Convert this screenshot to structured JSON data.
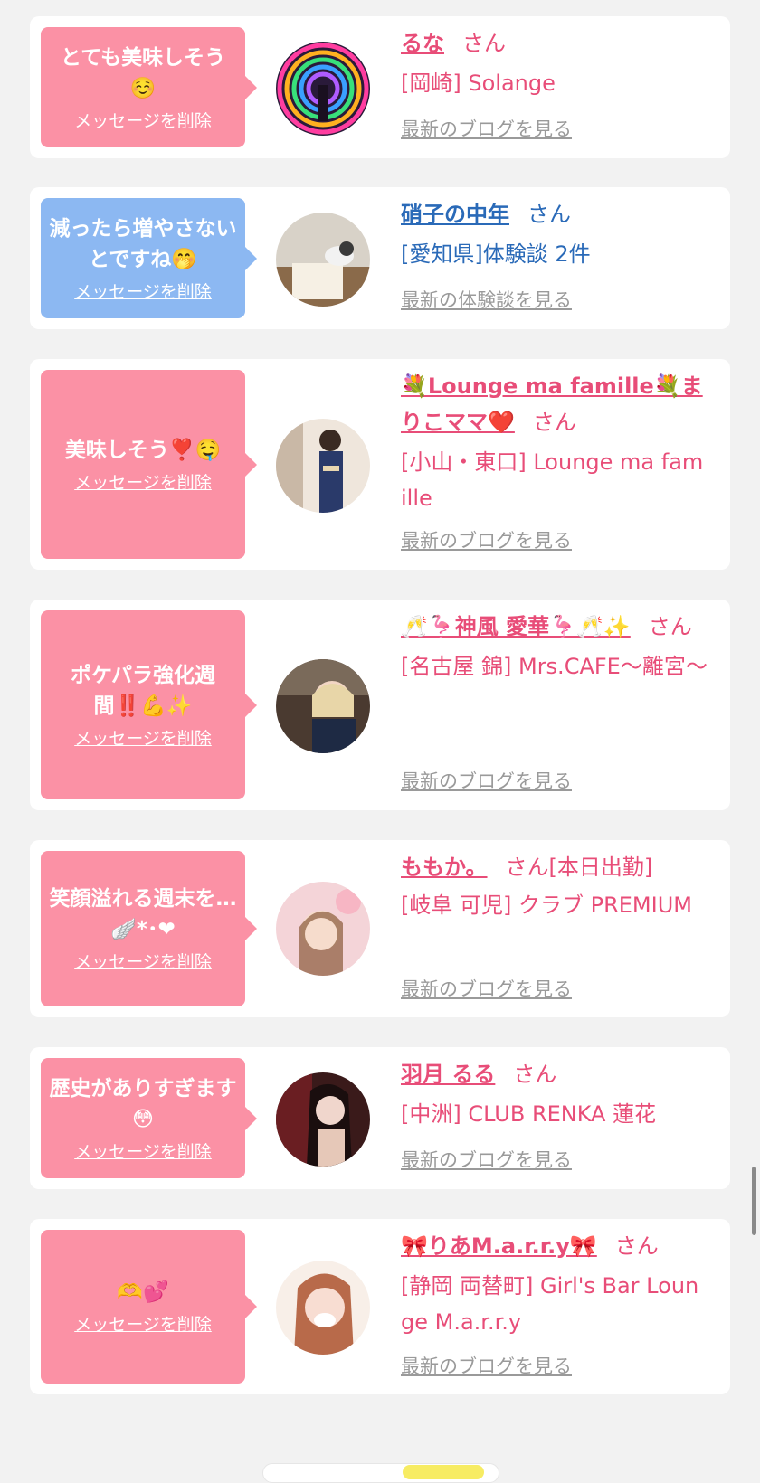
{
  "entries": [
    {
      "message": "とても美味しそう☺️",
      "delete_label": "メッセージを削除",
      "name": "るな",
      "honorific": "さん",
      "store": "[岡崎] Solange",
      "link": "最新のブログを見る"
    },
    {
      "message": "減ったら増やさないとですね🤭",
      "delete_label": "メッセージを削除",
      "name": "硝子の中年",
      "honorific": "さん",
      "store": "[愛知県]体験談 2件",
      "link": "最新の体験談を見る"
    },
    {
      "message": "美味しそう❣️🤤",
      "delete_label": "メッセージを削除",
      "name": "💐Lounge ma famille💐まりこママ❤️",
      "honorific": "さん",
      "store": "[小山・東口] Lounge ma famille",
      "link": "最新のブログを見る"
    },
    {
      "message": "ポケパラ強化週間‼️💪✨",
      "delete_label": "メッセージを削除",
      "name": "🥂🦩神風 愛華🦩🥂✨",
      "honorific": "さん",
      "store": "[名古屋 錦] Mrs.CAFE〜離宮〜",
      "link": "最新のブログを見る"
    },
    {
      "message": "笑顔溢れる週末を…🪽*･❤",
      "delete_label": "メッセージを削除",
      "name": "ももか。",
      "honorific": "さん",
      "status": "[本日出勤]",
      "store": "[岐阜 可児] クラブ PREMIUM",
      "link": "最新のブログを見る"
    },
    {
      "message": "歴史がありすぎます😳",
      "delete_label": "メッセージを削除",
      "name": "羽月 るる",
      "honorific": "さん",
      "store": "[中洲] CLUB RENKA 蓮花",
      "link": "最新のブログを見る"
    },
    {
      "message": "🫶💕",
      "delete_label": "メッセージを削除",
      "name": "🎀りあM.a.r.r.y🎀",
      "honorific": "さん",
      "store": "[静岡 両替町] Girl's Bar Lounge M.a.r.r.y",
      "link": "最新のブログを見る"
    }
  ]
}
